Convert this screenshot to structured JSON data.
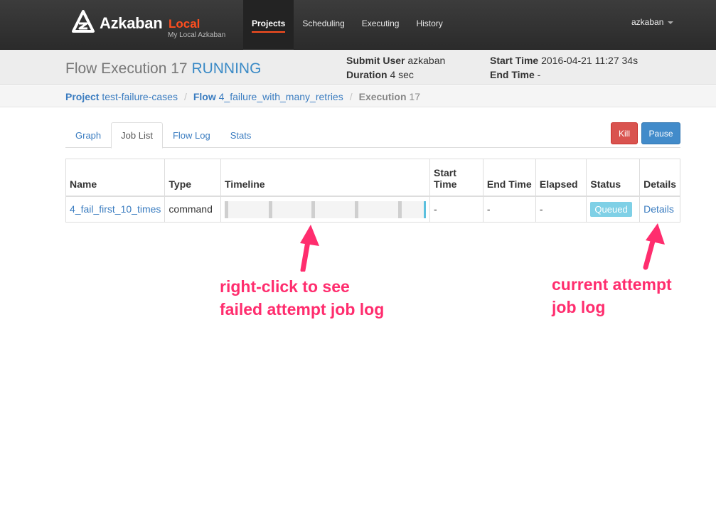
{
  "navbar": {
    "brand_name": "Azkaban",
    "brand_env": "Local",
    "brand_subtitle": "My Local Azkaban",
    "items": [
      {
        "label": "Projects",
        "active": true
      },
      {
        "label": "Scheduling",
        "active": false
      },
      {
        "label": "Executing",
        "active": false
      },
      {
        "label": "History",
        "active": false
      }
    ],
    "user": "azkaban"
  },
  "header": {
    "title": "Flow Execution 17",
    "status": "RUNNING",
    "submit_user_label": "Submit User",
    "submit_user": "azkaban",
    "duration_label": "Duration",
    "duration": "4 sec",
    "start_time_label": "Start Time",
    "start_time": "2016-04-21 11:27 34s",
    "end_time_label": "End Time",
    "end_time": "-"
  },
  "breadcrumb": {
    "project_label": "Project",
    "project": "test-failure-cases",
    "flow_label": "Flow",
    "flow": "4_failure_with_many_retries",
    "execution_label": "Execution",
    "execution": "17"
  },
  "tabs": [
    {
      "label": "Graph",
      "active": false
    },
    {
      "label": "Job List",
      "active": true
    },
    {
      "label": "Flow Log",
      "active": false
    },
    {
      "label": "Stats",
      "active": false
    }
  ],
  "actions": {
    "kill_label": "Kill",
    "pause_label": "Pause"
  },
  "table": {
    "headers": {
      "name": "Name",
      "type": "Type",
      "timeline": "Timeline",
      "start_time_1": "Start",
      "start_time_2": "Time",
      "end_time": "End Time",
      "elapsed": "Elapsed",
      "status": "Status",
      "details": "Details"
    },
    "rows": [
      {
        "name": "4_fail_first_10_times",
        "type": "command",
        "start_time": "-",
        "end_time": "-",
        "elapsed": "-",
        "status": "Queued",
        "details": "Details"
      }
    ]
  },
  "annotations": {
    "left_line1": "right-click to see",
    "left_line2": "failed attempt job log",
    "right_line1": "current attempt",
    "right_line2": "job log",
    "color": "#ff2d6e"
  },
  "colors": {
    "accent": "#ff4e1f",
    "link": "#3a7cc0",
    "running": "#3a8ac6",
    "kill": "#d9534f",
    "pause": "#428bca",
    "queued": "#7fd0e6"
  }
}
